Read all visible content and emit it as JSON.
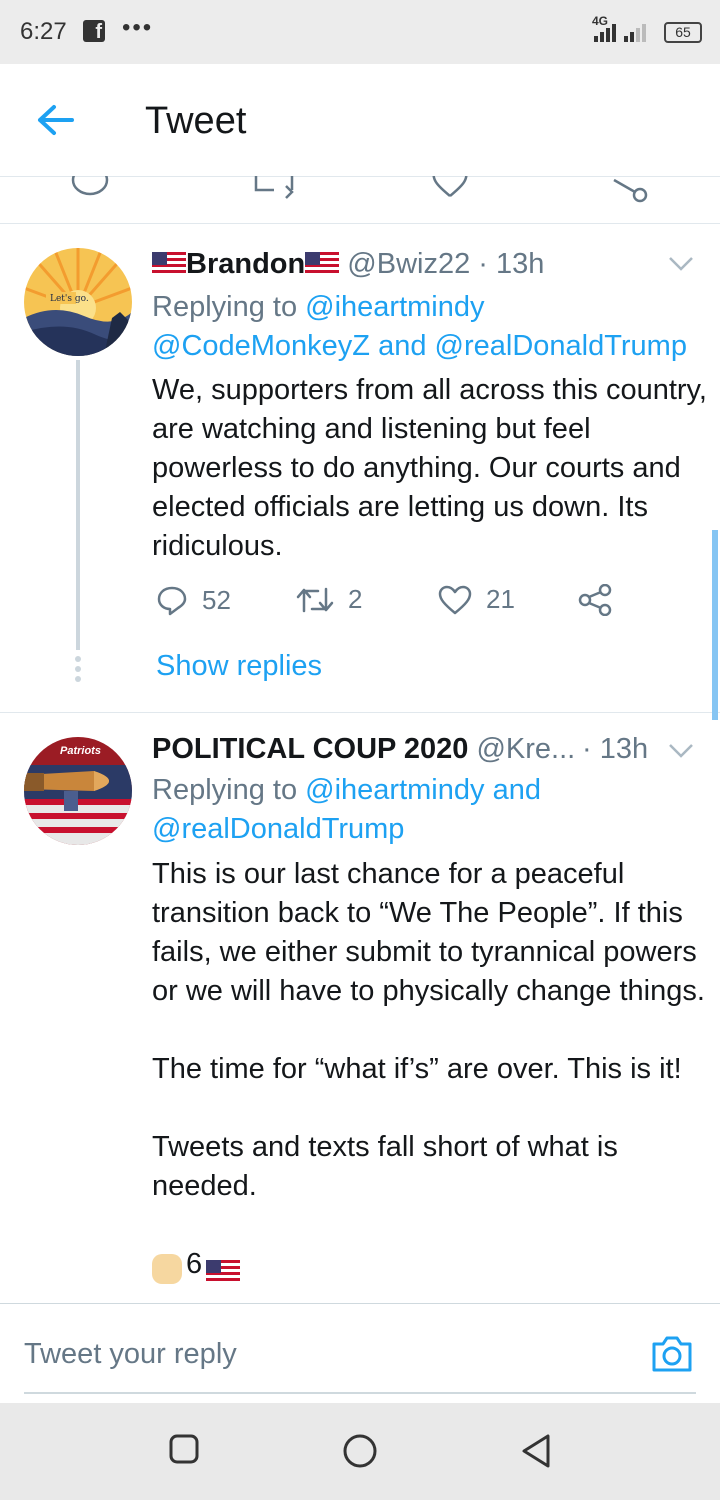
{
  "status_bar": {
    "time": "6:27",
    "network_label": "4G",
    "battery": "65"
  },
  "header": {
    "title": "Tweet"
  },
  "tweets": [
    {
      "display_name": "Brandon",
      "handle": "@Bwiz22",
      "time": "· 13h",
      "replying_prefix": "Replying to",
      "mention1": "@iheartmindy",
      "mention2": "@CodeMonkeyZ",
      "joiner": "and",
      "mention3": "@realDonaldTrump",
      "paragraphs": [
        "We, supporters from all across this country, are watching and listening but feel powerless to do anything. Our courts and elected officials are letting us down. Its ridiculous."
      ],
      "reply_count": "52",
      "retweet_count": "2",
      "like_count": "21",
      "show_replies": "Show replies",
      "avatar_text": "Let's go."
    },
    {
      "display_name": "POLITICAL COUP 2020",
      "handle": "@Kre...",
      "time": "· 13h",
      "replying_prefix": "Replying to",
      "mention1": "@iheartmindy",
      "joiner": "and",
      "mention2": "@realDonaldTrump",
      "paragraphs": [
        "This is our last chance for a peaceful transition back to “We The People”. If this fails, we either submit to tyrannical powers or we will have to physically change things.",
        "The time for “what if’s” are over. This is it!",
        "Tweets and texts fall short of what is needed."
      ],
      "partial_line": "6",
      "avatar_text": "Patriots"
    }
  ],
  "reply_bar": {
    "placeholder": "Tweet your reply"
  },
  "colors": {
    "accent": "#1da1f2",
    "secondary_text": "#657786",
    "divider": "#e1e8ed"
  }
}
